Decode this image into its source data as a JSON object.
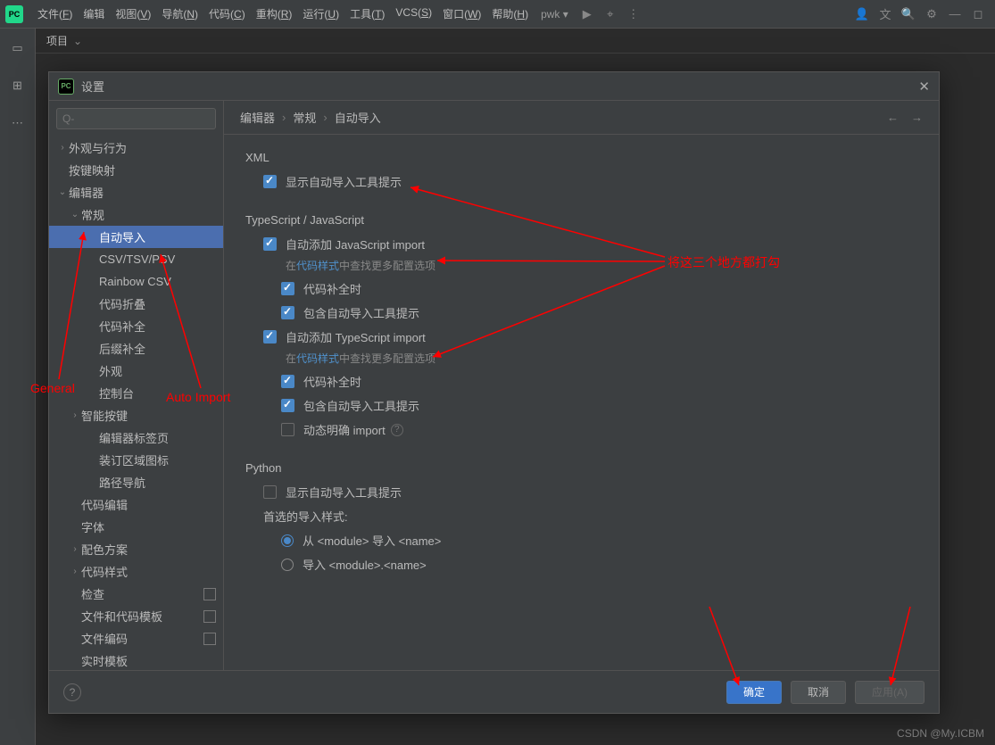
{
  "menubar": {
    "items": [
      "文件(F)",
      "编辑",
      "视图(V)",
      "导航(N)",
      "代码(C)",
      "重构(R)",
      "运行(U)",
      "工具(T)",
      "VCS(S)",
      "窗口(W)",
      "帮助(H)"
    ],
    "project": "pwk"
  },
  "projrow": {
    "label": "项目"
  },
  "dialog": {
    "title": "设置",
    "search_placeholder": "Q-",
    "breadcrumb": [
      "编辑器",
      "常规",
      "自动导入"
    ],
    "tree": [
      {
        "label": "外观与行为",
        "depth": 0,
        "arrow": ">"
      },
      {
        "label": "按键映射",
        "depth": 0,
        "arrow": ""
      },
      {
        "label": "编辑器",
        "depth": 0,
        "arrow": "v"
      },
      {
        "label": "常规",
        "depth": 1,
        "arrow": "v"
      },
      {
        "label": "自动导入",
        "depth": 2,
        "arrow": "",
        "sel": true
      },
      {
        "label": "CSV/TSV/PSV",
        "depth": 2,
        "arrow": ""
      },
      {
        "label": "Rainbow CSV",
        "depth": 2,
        "arrow": ""
      },
      {
        "label": "代码折叠",
        "depth": 2,
        "arrow": ""
      },
      {
        "label": "代码补全",
        "depth": 2,
        "arrow": ""
      },
      {
        "label": "后缀补全",
        "depth": 2,
        "arrow": ""
      },
      {
        "label": "外观",
        "depth": 2,
        "arrow": ""
      },
      {
        "label": "控制台",
        "depth": 2,
        "arrow": ""
      },
      {
        "label": "智能按键",
        "depth": 1,
        "arrow": ">"
      },
      {
        "label": "编辑器标签页",
        "depth": 2,
        "arrow": ""
      },
      {
        "label": "装订区域图标",
        "depth": 2,
        "arrow": ""
      },
      {
        "label": "路径导航",
        "depth": 2,
        "arrow": ""
      },
      {
        "label": "代码编辑",
        "depth": 1,
        "arrow": ""
      },
      {
        "label": "字体",
        "depth": 1,
        "arrow": ""
      },
      {
        "label": "配色方案",
        "depth": 1,
        "arrow": ">"
      },
      {
        "label": "代码样式",
        "depth": 1,
        "arrow": ">"
      },
      {
        "label": "检查",
        "depth": 1,
        "arrow": "",
        "badge": true
      },
      {
        "label": "文件和代码模板",
        "depth": 1,
        "arrow": "",
        "badge": true
      },
      {
        "label": "文件编码",
        "depth": 1,
        "arrow": "",
        "badge": true
      },
      {
        "label": "实时模板",
        "depth": 1,
        "arrow": ""
      }
    ],
    "sections": {
      "xml": {
        "title": "XML",
        "cb1": "显示自动导入工具提示"
      },
      "tsjs": {
        "title": "TypeScript / JavaScript",
        "addjs": "自动添加 JavaScript import",
        "hint_prefix": "在",
        "hint_link": "代码样式",
        "hint_suffix": "中查找更多配置选项",
        "comp": "代码补全时",
        "tooltip": "包含自动导入工具提示",
        "addts": "自动添加 TypeScript import",
        "dyn": "动态明确 import"
      },
      "python": {
        "title": "Python",
        "show": "显示自动导入工具提示",
        "pref": "首选的导入样式:",
        "r1": "从 <module> 导入 <name>",
        "r2": "导入 <module>.<name>"
      }
    },
    "buttons": {
      "ok": "确定",
      "cancel": "取消",
      "apply": "应用(A)"
    }
  },
  "annot": {
    "general": "General",
    "autoimport": "Auto Import",
    "checkall": "将这三个地方都打勾"
  },
  "watermark": "CSDN @My.ICBM"
}
